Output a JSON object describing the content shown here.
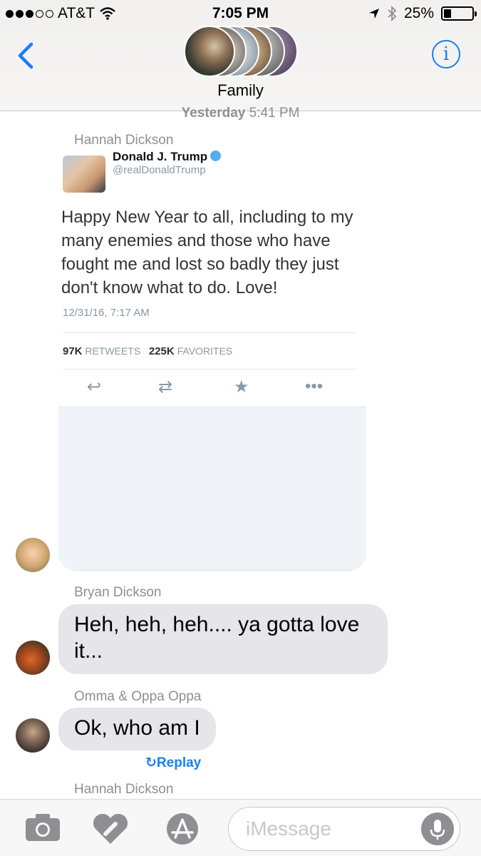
{
  "status": {
    "carrier": "AT&T",
    "time": "7:05 PM",
    "battery": "25%",
    "battery_level": 0.25
  },
  "header": {
    "group_name": "Family",
    "info_label": "i"
  },
  "thread": {
    "timestamp_day": "Yesterday",
    "timestamp_time": "5:41 PM",
    "messages": [
      {
        "sender": "Hannah Dickson",
        "tweet": {
          "name": "Donald J. Trump",
          "handle": "@realDonaldTrump",
          "text": "Happy New Year to all, including to my many enemies and those who have fought me and lost so badly they just don't know what to do. Love!",
          "date": "12/31/16, 7:17 AM",
          "retweets_count": "97K",
          "retweets_label": "RETWEETS",
          "favorites_count": "225K",
          "favorites_label": "FAVORITES"
        }
      },
      {
        "sender": "Bryan  Dickson",
        "text": "Heh, heh, heh.... ya gotta love it..."
      },
      {
        "sender": "Omma & Oppa Oppa",
        "text": "Ok, who am I",
        "action": "Replay"
      },
      {
        "sender": "Hannah Dickson"
      }
    ]
  },
  "compose": {
    "placeholder": "iMessage"
  },
  "colors": {
    "accent": "#1a7ff2",
    "bubble_received": "#e5e5ea",
    "meta_text": "#8e8e93"
  }
}
